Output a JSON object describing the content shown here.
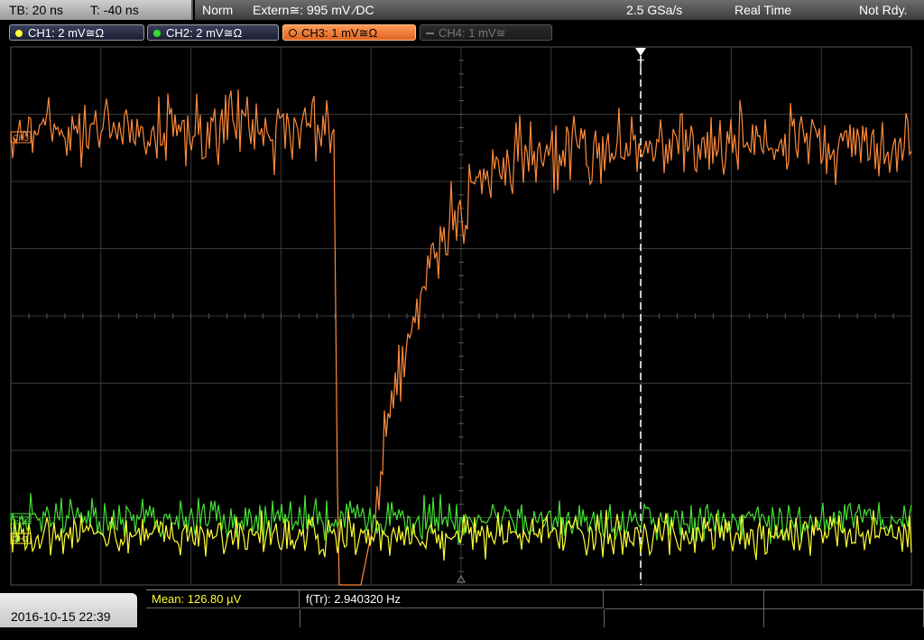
{
  "status_bar": {
    "timebase": "TB: 20 ns",
    "trigger_time": "T: -40 ns",
    "trigger_mode": "Norm",
    "trigger_source": "Extern≅: 995 mV ⁄DC",
    "sample_rate": "2.5 GSa/s",
    "acquisition": "Real Time",
    "state": "Not Rdy."
  },
  "channels": [
    {
      "label": "CH1: 2 mV≅Ω",
      "color": "#ffff33"
    },
    {
      "label": "CH2: 2 mV≅Ω",
      "color": "#33dd33"
    },
    {
      "label": "CH3: 1 mV≅Ω",
      "color": "#ff8a3a"
    },
    {
      "label": "CH4: 1 mV≅",
      "color": "#777777"
    }
  ],
  "markers": {
    "trigger_label": "T",
    "ch3_marker": "CH3",
    "ch1_marker": "CH1",
    "ch2_marker": "CH2"
  },
  "measurements": {
    "mean": "Mean: 126.80 µV",
    "frequency": "f(Tr): 2.940320 Hz"
  },
  "datetime": "2016-10-15 22:39",
  "colors": {
    "grid": "#3a3a3a",
    "trace_ch1": "#ffff33",
    "trace_ch2": "#44e033",
    "trace_ch3": "#ff8a3a"
  }
}
